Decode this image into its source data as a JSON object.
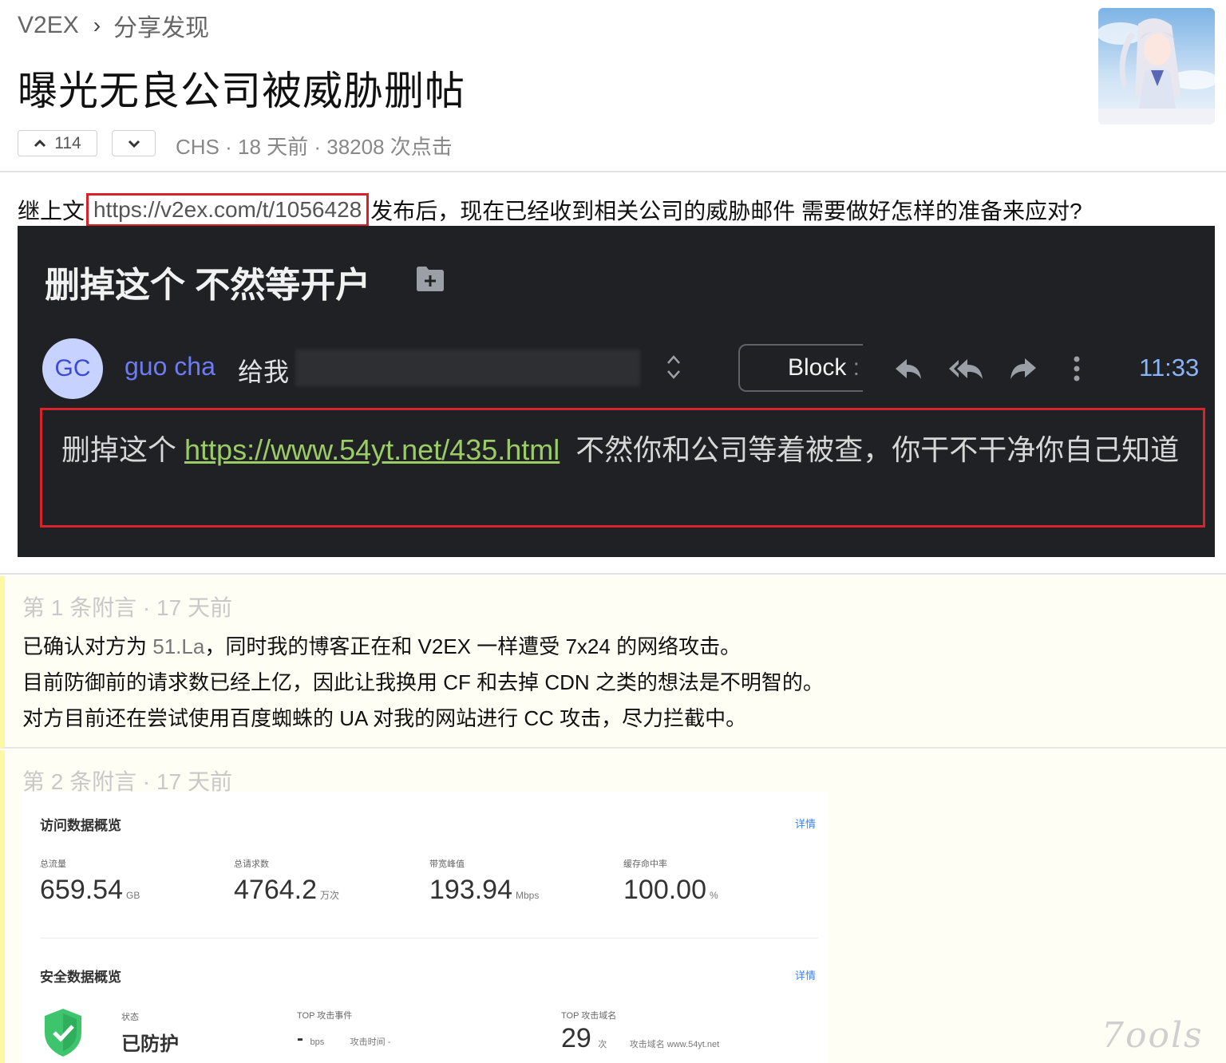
{
  "breadcrumb": {
    "site": "V2EX",
    "separator": "›",
    "node": "分享发现"
  },
  "topic": {
    "title": "曝光无良公司被威胁删帖",
    "upvotes": "114",
    "meta": "CHS · 18 天前 · 38208 次点击"
  },
  "post": {
    "intro_before": "继上文",
    "intro_link": "https://v2ex.com/t/1056428",
    "intro_after": "发布后，现在已经收到相关公司的威胁邮件 需要做好怎样的准备来应对?"
  },
  "email": {
    "subject": "删掉这个 不然等开户",
    "avatar_initials": "GC",
    "sender": "guo cha",
    "to_label": "给我",
    "block_label": "Block",
    "time": "11:33",
    "message_before": "删掉这个 ",
    "message_link": "https://www.54yt.net/435.html",
    "message_after": "  不然你和公司等着被查，你干不干净你自己知道",
    "icons": [
      "folder-add-icon",
      "chevron-updown-icon",
      "reply-icon",
      "reply-all-icon",
      "forward-icon",
      "more-vertical-icon"
    ]
  },
  "appendices": [
    {
      "header": "第 1 条附言 · 17 天前",
      "line1_before": "已确认对方为 ",
      "line1_highlight": "51.La",
      "line1_after": "，同时我的博客正在和 V2EX 一样遭受 7x24 的网络攻击。",
      "line2": "目前防御前的请求数已经上亿，因此让我换用 CF 和去掉 CDN 之类的想法是不明智的。",
      "line3": "对方目前还在尝试使用百度蜘蛛的 UA 对我的网站进行 CC 攻击，尽力拦截中。"
    },
    {
      "header": "第 2 条附言 · 17 天前"
    }
  ],
  "dashboard": {
    "access_title": "访问数据概览",
    "detail_link": "详情",
    "stats": [
      {
        "label": "总流量",
        "value": "659.54",
        "unit": "GB"
      },
      {
        "label": "总请求数",
        "value": "4764.2",
        "unit": "万次"
      },
      {
        "label": "带宽峰值",
        "value": "193.94",
        "unit": "Mbps"
      },
      {
        "label": "缓存命中率",
        "value": "100.00",
        "unit": "%"
      }
    ],
    "security_title": "安全数据概览",
    "security_detail_link": "详情",
    "status_label": "状态",
    "status_value": "已防护",
    "top_event_label": "TOP 攻击事件",
    "top_event_value": "-",
    "top_event_unit": "bps",
    "top_event_time": "攻击时间 -",
    "top_domain_label": "TOP 攻击域名",
    "top_domain_value": "29",
    "top_domain_unit": "次",
    "top_domain_name": "攻击域名  www.54yt.net"
  },
  "watermark": "7ools",
  "colors": {
    "highlight_box": "#d8232a",
    "email_bg": "#202124",
    "email_link": "#9ccc65",
    "sender": "#6b7cf5",
    "append_bg": "#fffef4"
  }
}
